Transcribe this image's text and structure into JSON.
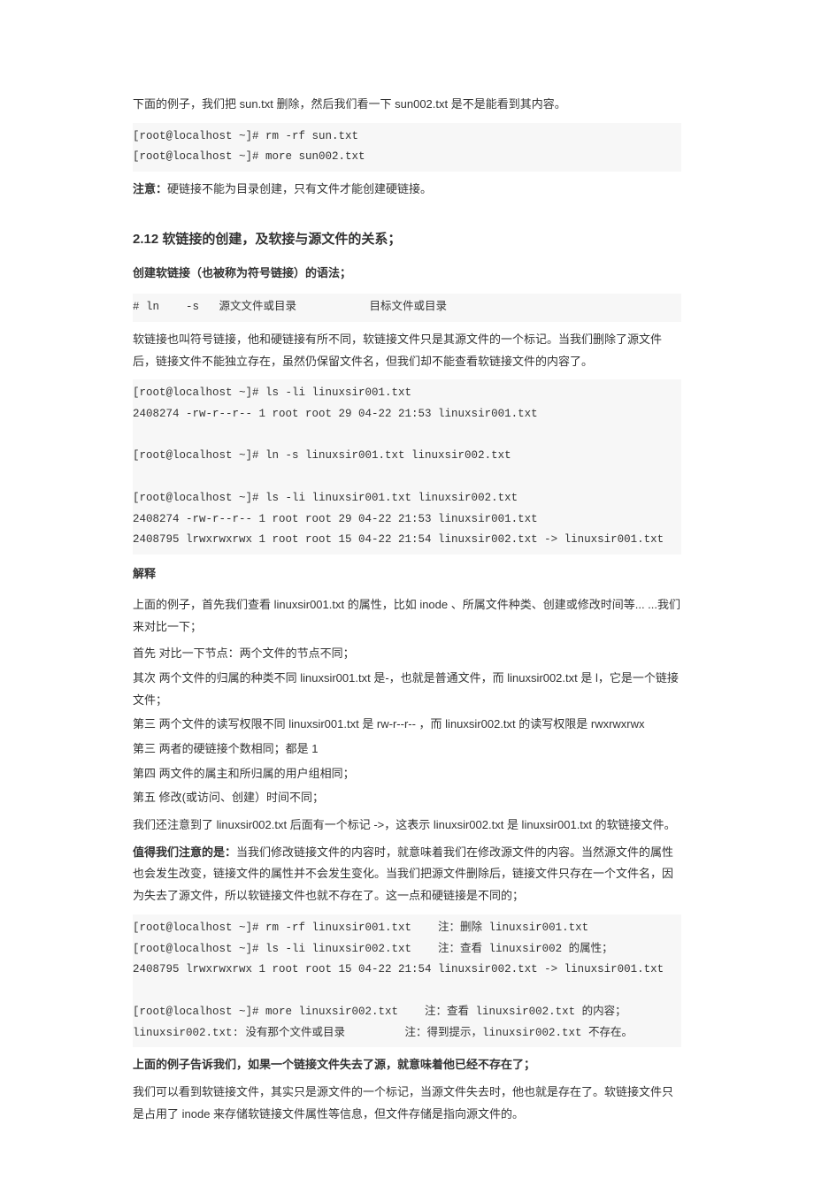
{
  "p1": "下面的例子，我们把 sun.txt 删除，然后我们看一下 sun002.txt 是不是能看到其内容。",
  "code1": {
    "l1": "[root@localhost ~]# rm -rf sun.txt",
    "l2": "[root@localhost ~]# more sun002.txt"
  },
  "p2_bold": "注意：",
  "p2_rest": "硬链接不能为目录创建，只有文件才能创建硬链接。",
  "h_212": "2.12 软链接的创建，及软接与源文件的关系；",
  "sub1": "创建软链接（也被称为符号链接）的语法；",
  "code2": {
    "l1": "# ln    -s   源文文件或目录           目标文件或目录"
  },
  "p3": "软链接也叫符号链接，他和硬链接有所不同，软链接文件只是其源文件的一个标记。当我们删除了源文件后，链接文件不能独立存在，虽然仍保留文件名，但我们却不能查看软链接文件的内容了。",
  "code3": {
    "l1": "[root@localhost ~]# ls -li linuxsir001.txt",
    "l2": "2408274 -rw-r--r-- 1 root root 29 04-22 21:53 linuxsir001.txt",
    "l3": "",
    "l4": "[root@localhost ~]# ln -s linuxsir001.txt linuxsir002.txt",
    "l5": "",
    "l6": "[root@localhost ~]# ls -li linuxsir001.txt linuxsir002.txt",
    "l7": "2408274 -rw-r--r-- 1 root root 29 04-22 21:53 linuxsir001.txt",
    "l8": "2408795 lrwxrwxrwx 1 root root 15 04-22 21:54 linuxsir002.txt -> linuxsir001.txt"
  },
  "sub2": "解释",
  "p4": "上面的例子，首先我们查看 linuxsir001.txt 的属性，比如 inode 、所属文件种类、创建或修改时间等... ...我们来对比一下；",
  "list": {
    "l1": "首先 对比一下节点：两个文件的节点不同；",
    "l2": "其次 两个文件的归属的种类不同 linuxsir001.txt 是-，也就是普通文件，而 linuxsir002.txt 是 l，它是一个链接文件；",
    "l3": "第三 两个文件的读写权限不同 linuxsir001.txt 是 rw-r--r-- ，而 linuxsir002.txt 的读写权限是 rwxrwxrwx",
    "l4": "第三 两者的硬链接个数相同；都是 1",
    "l5": "第四 两文件的属主和所归属的用户组相同；",
    "l6": "第五 修改(或访问、创建）时间不同；"
  },
  "p5": "我们还注意到了 linuxsir002.txt 后面有一个标记 ->，这表示 linuxsir002.txt  是 linuxsir001.txt 的软链接文件。",
  "p6_bold": "值得我们注意的是：",
  "p6_rest": "当我们修改链接文件的内容时，就意味着我们在修改源文件的内容。当然源文件的属性也会发生改变，链接文件的属性并不会发生变化。当我们把源文件删除后，链接文件只存在一个文件名，因为失去了源文件，所以软链接文件也就不存在了。这一点和硬链接是不同的；",
  "code4": {
    "l1": "[root@localhost ~]# rm -rf linuxsir001.txt    注：删除 linuxsir001.txt",
    "l2": "[root@localhost ~]# ls -li linuxsir002.txt    注：查看 linuxsir002 的属性；",
    "l3": "2408795 lrwxrwxrwx 1 root root 15 04-22 21:54 linuxsir002.txt -> linuxsir001.txt",
    "l4": "",
    "l5": "[root@localhost ~]# more linuxsir002.txt    注：查看 linuxsir002.txt 的内容；",
    "l6": "linuxsir002.txt: 没有那个文件或目录         注：得到提示，linuxsir002.txt 不存在。"
  },
  "p7": "上面的例子告诉我们，如果一个链接文件失去了源，就意味着他已经不存在了；",
  "p8": "我们可以看到软链接文件，其实只是源文件的一个标记，当源文件失去时，他也就是存在了。软链接文件只是占用了 inode 来存储软链接文件属性等信息，但文件存储是指向源文件的。"
}
